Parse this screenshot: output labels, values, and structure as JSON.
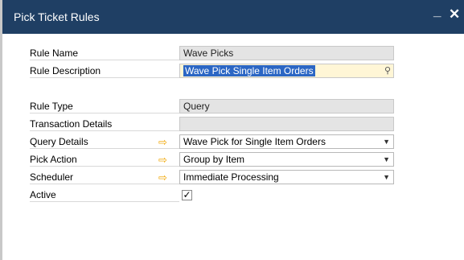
{
  "window": {
    "title": "Pick Ticket Rules",
    "minimize": "_",
    "close": "✕"
  },
  "form": {
    "rule_name": {
      "label": "Rule Name",
      "value": "Wave Picks"
    },
    "rule_description": {
      "label": "Rule Description",
      "value": "Wave Pick Single Item Orders"
    },
    "rule_type": {
      "label": "Rule Type",
      "value": "Query"
    },
    "transaction_details": {
      "label": "Transaction Details",
      "value": ""
    },
    "query_details": {
      "label": "Query Details",
      "value": "Wave Pick for Single Item Orders"
    },
    "pick_action": {
      "label": "Pick Action",
      "value": "Group by Item"
    },
    "scheduler": {
      "label": "Scheduler",
      "value": "Immediate Processing"
    },
    "active": {
      "label": "Active",
      "checked": true,
      "mark": "✓"
    }
  },
  "icons": {
    "link_arrow": "⇨",
    "dropdown": "▼",
    "choose_from_list": "⚲"
  },
  "colors": {
    "titlebar": "#1f3f64",
    "selection": "#2b66c4",
    "link_arrow": "#f0a500",
    "edit_bg": "#fff6d6",
    "readonly_bg": "#e4e4e4"
  }
}
